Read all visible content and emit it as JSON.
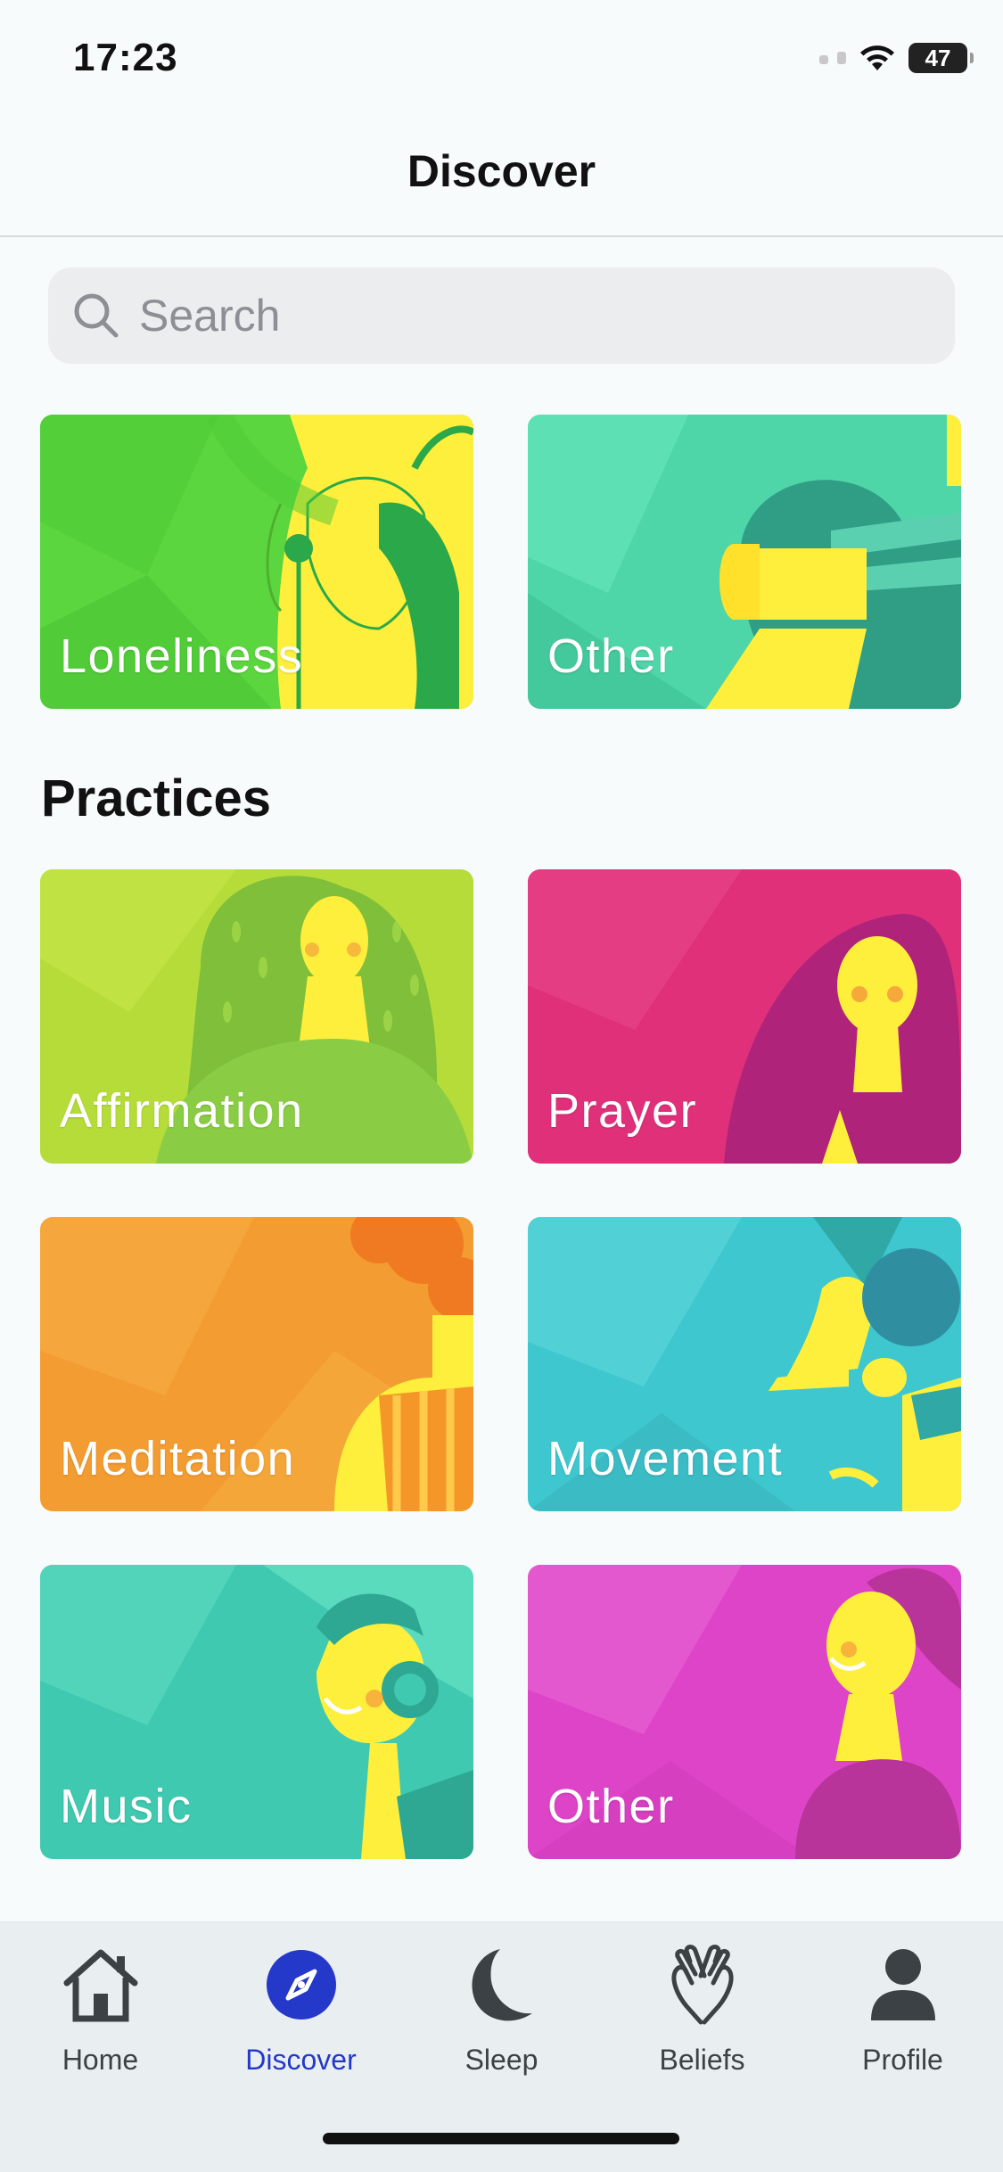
{
  "status": {
    "time": "17:23",
    "battery": "47"
  },
  "nav": {
    "title": "Discover"
  },
  "search": {
    "placeholder": "Search"
  },
  "top_cards": [
    {
      "label": "Loneliness"
    },
    {
      "label": "Other"
    }
  ],
  "practices": {
    "title": "Practices",
    "cards": [
      {
        "label": "Affirmation"
      },
      {
        "label": "Prayer"
      },
      {
        "label": "Meditation"
      },
      {
        "label": "Movement"
      },
      {
        "label": "Music"
      },
      {
        "label": "Other"
      }
    ]
  },
  "tabs": [
    {
      "label": "Home",
      "icon": "house-icon"
    },
    {
      "label": "Discover",
      "icon": "compass-icon",
      "active": true
    },
    {
      "label": "Sleep",
      "icon": "moon-icon"
    },
    {
      "label": "Beliefs",
      "icon": "praying-hands-icon"
    },
    {
      "label": "Profile",
      "icon": "person-icon"
    }
  ],
  "colors": {
    "active_tab": "#2438c9",
    "loneliness": "#5cd63f",
    "other_teal": "#4fd6a8",
    "affirmation": "#b6dc3a",
    "prayer": "#e0307a",
    "meditation": "#f39c32",
    "movement": "#3fc7cf",
    "music": "#3fc9b0",
    "other_magenta": "#dd44c8"
  }
}
